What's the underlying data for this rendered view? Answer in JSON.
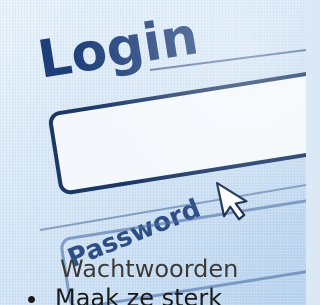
{
  "login_screen": {
    "heading": "Login",
    "password_label": "Password"
  },
  "overlay": {
    "caption": "Wachtwoorden",
    "bullet_text": "Maak ze sterk"
  },
  "colors": {
    "heading_color": "#1f3f7a",
    "field_border": "#1b3766",
    "background_light": "#eaf3fb",
    "background_dark": "#b6d2ee"
  },
  "icons": {
    "cursor": "mouse-pointer-icon"
  }
}
